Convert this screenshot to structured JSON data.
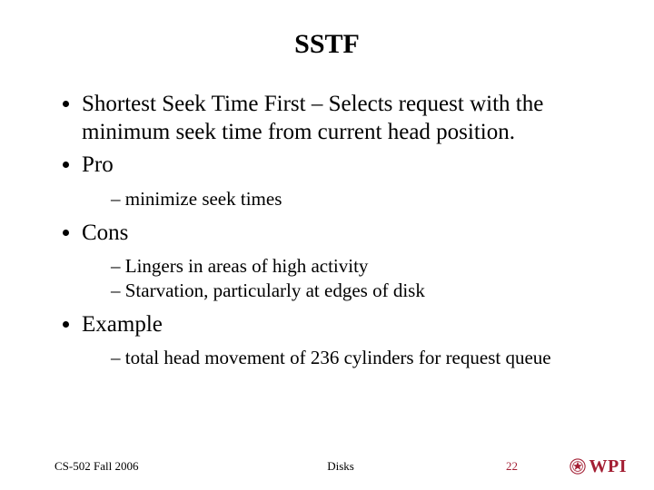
{
  "title": "SSTF",
  "bullets": {
    "b1": "Shortest Seek Time First – Selects request with the minimum seek time from current head position.",
    "b2": "Pro",
    "b2_1": "minimize seek times",
    "b3": "Cons",
    "b3_1": "Lingers in areas of high activity",
    "b3_2": "Starvation, particularly at edges of disk",
    "b4": "Example",
    "b4_1": "total head movement of 236 cylinders for request queue"
  },
  "footer": {
    "left": "CS-502 Fall 2006",
    "center": "Disks",
    "page": "22",
    "logo_text": "WPI"
  },
  "colors": {
    "accent": "#a31f34"
  }
}
